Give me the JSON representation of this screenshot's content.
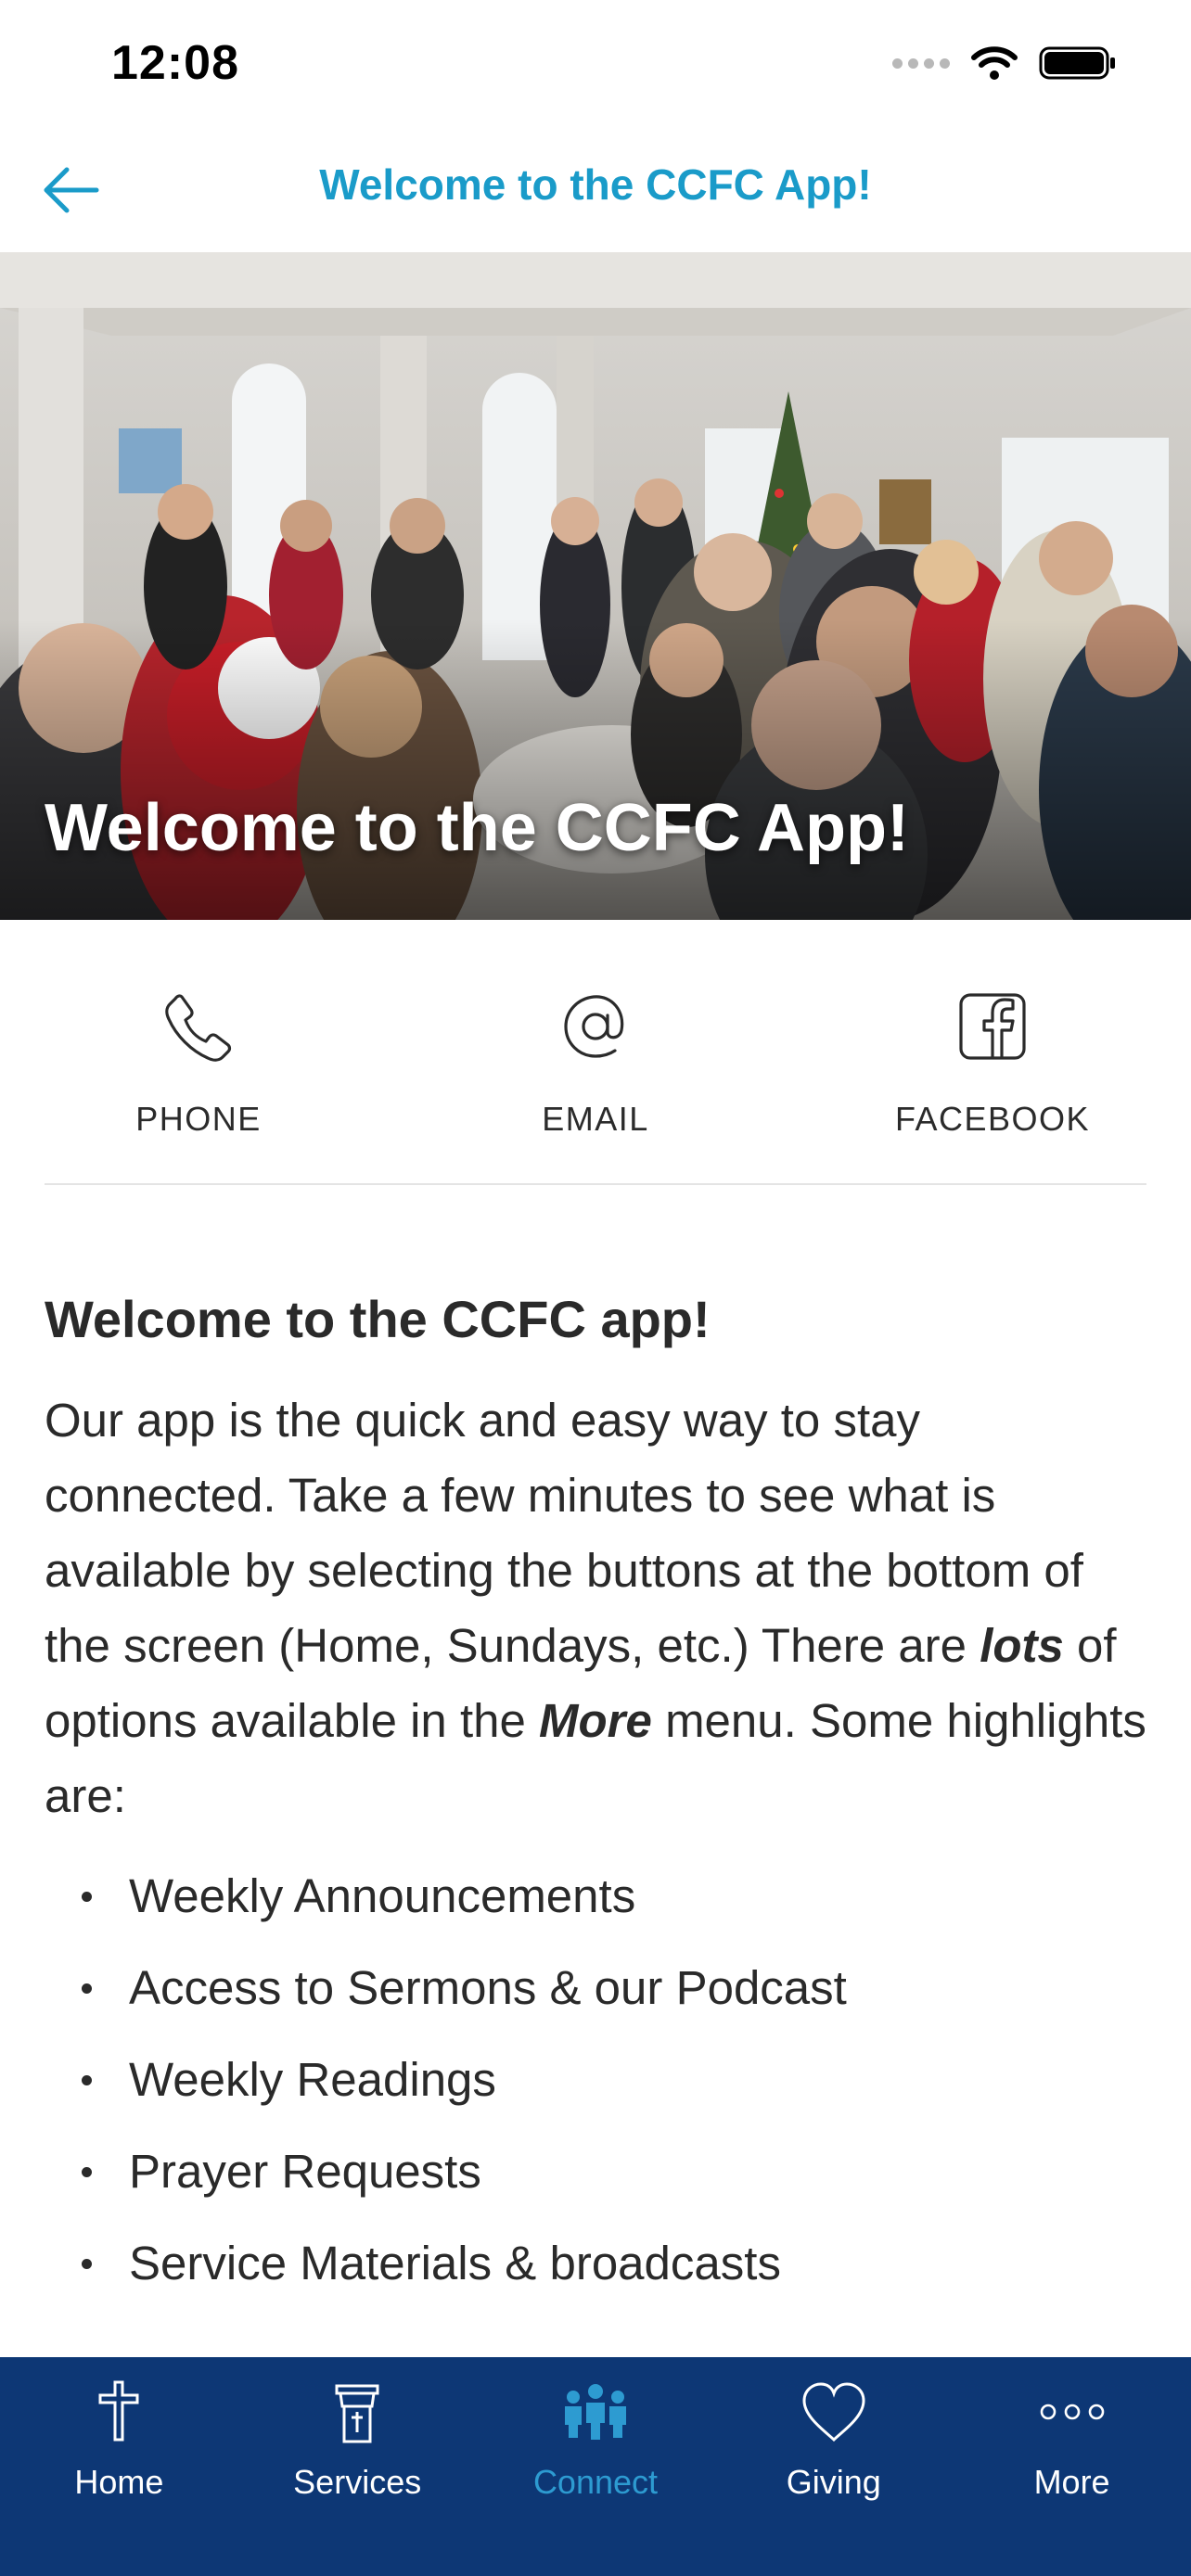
{
  "status_bar": {
    "time": "12:08"
  },
  "nav": {
    "title": "Welcome to the CCFC App!"
  },
  "hero": {
    "caption": "Welcome to the CCFC App!"
  },
  "contact": {
    "items": [
      {
        "label": "PHONE",
        "icon": "phone-icon"
      },
      {
        "label": "EMAIL",
        "icon": "at-sign-icon"
      },
      {
        "label": "FACEBOOK",
        "icon": "facebook-icon"
      }
    ]
  },
  "article": {
    "heading": "Welcome to the CCFC app!",
    "intro_1": "Our app is the quick and easy way to stay connected. Take a few minutes to see what is available by selecting the buttons at the bottom of the screen (Home, Sundays, etc.) There are ",
    "intro_em_1": "lots",
    "intro_2": " of options available in the ",
    "intro_em_2": "More",
    "intro_3": " menu. Some highlights are:",
    "bullets": [
      "Weekly Announcements",
      "Access to Sermons & our Podcast",
      "Weekly Readings",
      "Prayer Requests",
      "Service Materials & broadcasts"
    ]
  },
  "tab_bar": {
    "tabs": [
      {
        "label": "Home",
        "icon": "cross-icon"
      },
      {
        "label": "Services",
        "icon": "pulpit-icon"
      },
      {
        "label": "Connect",
        "icon": "people-icon",
        "active": true
      },
      {
        "label": "Giving",
        "icon": "heart-icon"
      },
      {
        "label": "More",
        "icon": "more-dots-icon"
      }
    ]
  },
  "colors": {
    "accent": "#1a9bc9",
    "tab_bar_bg": "#0d3775",
    "tab_active": "#2d9bd1"
  }
}
